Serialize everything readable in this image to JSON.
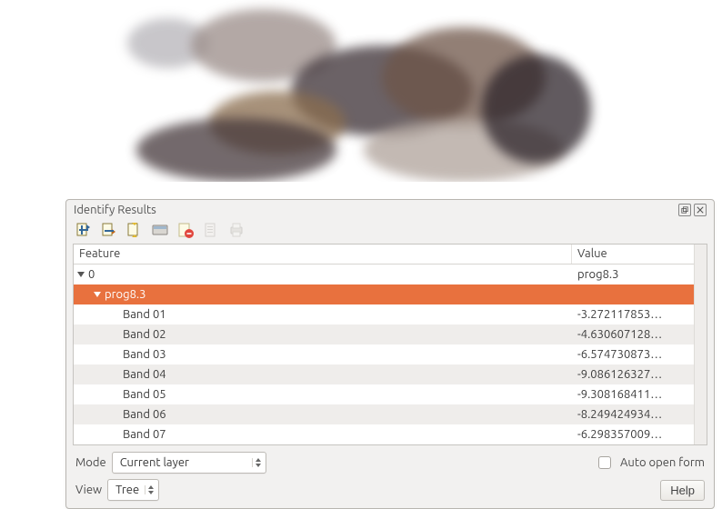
{
  "panel": {
    "title": "Identify Results"
  },
  "columns": {
    "feature": "Feature",
    "value": "Value"
  },
  "rows": [
    {
      "feature": "0",
      "value": "prog8.3",
      "indent": 1,
      "expander": true,
      "alt": false,
      "selected": false
    },
    {
      "feature": "prog8.3",
      "value": "",
      "indent": 2,
      "expander": true,
      "alt": false,
      "selected": true
    },
    {
      "feature": "Band 01",
      "value": "-3.272117853…",
      "indent": 3,
      "expander": false,
      "alt": false,
      "selected": false
    },
    {
      "feature": "Band 02",
      "value": "-4.630607128…",
      "indent": 3,
      "expander": false,
      "alt": true,
      "selected": false
    },
    {
      "feature": "Band 03",
      "value": "-6.574730873…",
      "indent": 3,
      "expander": false,
      "alt": false,
      "selected": false
    },
    {
      "feature": "Band 04",
      "value": "-9.086126327…",
      "indent": 3,
      "expander": false,
      "alt": true,
      "selected": false
    },
    {
      "feature": "Band 05",
      "value": "-9.308168411…",
      "indent": 3,
      "expander": false,
      "alt": false,
      "selected": false
    },
    {
      "feature": "Band 06",
      "value": "-8.249424934…",
      "indent": 3,
      "expander": false,
      "alt": true,
      "selected": false
    },
    {
      "feature": "Band 07",
      "value": "-6.298357009…",
      "indent": 3,
      "expander": false,
      "alt": false,
      "selected": false
    }
  ],
  "mode": {
    "label": "Mode",
    "selected": "Current layer"
  },
  "view": {
    "label": "View",
    "selected": "Tree"
  },
  "auto_open": {
    "label": "Auto open form",
    "checked": false
  },
  "help": {
    "label": "Help"
  },
  "toolbar_icons": {
    "expand_new": "expand-new-results-icon",
    "collapse": "collapse-all-icon",
    "expand_all": "expand-all-icon",
    "dock": "dock-panel-icon",
    "clear": "clear-results-icon",
    "copy": "copy-to-clipboard-icon",
    "print": "print-icon"
  }
}
